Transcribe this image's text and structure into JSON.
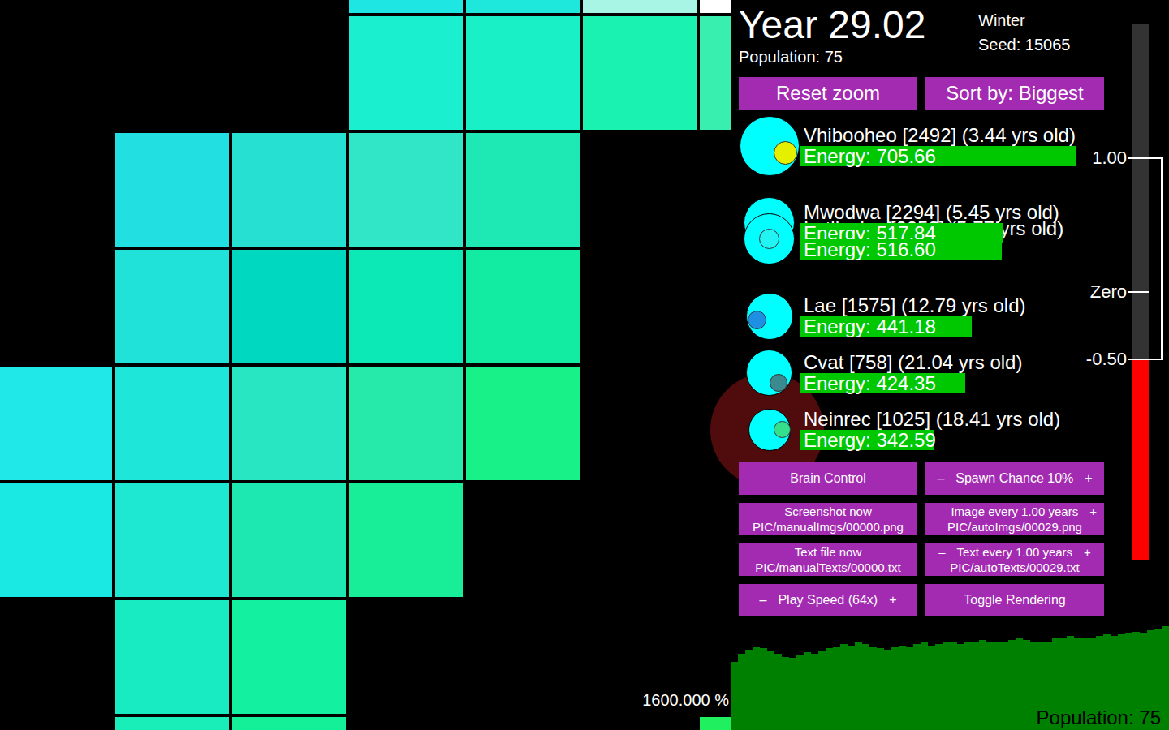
{
  "header": {
    "year": "Year 29.02",
    "season": "Winter",
    "seed": "Seed: 15065",
    "population": "Population: 75"
  },
  "top_buttons": [
    "Reset zoom",
    "Sort by: Biggest"
  ],
  "creatures": [
    {
      "name": "Vhibooheo [2492] (3.44 yrs old)",
      "energy": "Energy: 705.66",
      "level": 0.8,
      "color": "#e4f000"
    },
    {
      "name": "Mwodwa [2294] (5.45 yrs old)",
      "energy": "Energy: 517.84",
      "level": 0.588,
      "color": "#1a8ee0"
    },
    {
      "name": "Latihwius [2259] (5.77 yrs old)",
      "energy": "Energy: 516.60",
      "level": 0.586,
      "color": "#22f4f4"
    },
    {
      "name": "Lae [1575] (12.79 yrs old)",
      "energy": "Energy: 441.18",
      "level": 0.499,
      "color": "#1e90e4"
    },
    {
      "name": "Cvat [758] (21.04 yrs old)",
      "energy": "Energy: 424.35",
      "level": 0.481,
      "color": "#3a8a90"
    },
    {
      "name": "Neinrec [1025] (18.41 yrs old)",
      "energy": "Energy: 342.59",
      "level": 0.388,
      "color": "#34e08c"
    }
  ],
  "controls": [
    {
      "kind": "plain",
      "label": "Brain Control"
    },
    {
      "kind": "stepper",
      "minus": "–",
      "label": "Spawn Chance 10%",
      "plus": "+"
    },
    {
      "kind": "plain",
      "label": "Screenshot now",
      "sub": "PIC/manualImgs/00000.png"
    },
    {
      "kind": "stepper",
      "minus": "–",
      "label": "Image every 1.00 years",
      "plus": "+",
      "sub": "PIC/autoImgs/00029.png"
    },
    {
      "kind": "plain",
      "label": "Text file now",
      "sub": "PIC/manualTexts/00000.txt"
    },
    {
      "kind": "stepper",
      "minus": "–",
      "label": "Text every 1.00 years",
      "plus": "+",
      "sub": "PIC/autoTexts/00029.txt"
    },
    {
      "kind": "stepper",
      "minus": "–",
      "label": "Play Speed (64x)",
      "plus": "+"
    },
    {
      "kind": "plain",
      "label": "Toggle Rendering"
    }
  ],
  "temperature": {
    "level": 0.375,
    "ticks": [
      {
        "label": "1.00",
        "value": 1
      },
      {
        "label": "Zero",
        "value": 0
      },
      {
        "label": "-0.50",
        "value": -0.5
      }
    ]
  },
  "population_chart": {
    "label": "Population: 75",
    "values": [
      49,
      55,
      58,
      60,
      59,
      57,
      55,
      53,
      52,
      54,
      56,
      55,
      57,
      59,
      60,
      62,
      61,
      63,
      62,
      60,
      59,
      58,
      60,
      61,
      60,
      62,
      63,
      61,
      62,
      64,
      63,
      62,
      63,
      64,
      65,
      64,
      63,
      64,
      65,
      66,
      65,
      64,
      63,
      64,
      66,
      67,
      68,
      67,
      66,
      67,
      68,
      69,
      68,
      69,
      70,
      71,
      70,
      72,
      73,
      75
    ]
  },
  "map": {
    "zoom": "1600.000 %",
    "creatures": [
      {
        "color": "#a01818"
      }
    ],
    "tiles": [
      [
        null,
        null,
        null,
        "#1ee6e2",
        "#1ee8dc",
        "#a8f5e6",
        "#ffffff"
      ],
      [
        null,
        null,
        null,
        "#1aefd0",
        "#1af0c6",
        "#1af2b2",
        "#38efb0"
      ],
      [
        null,
        "#22e0e2",
        "#26e0d2",
        "#30e6c6",
        "#1ee8b4",
        null,
        null
      ],
      [
        null,
        "#20e2d8",
        "#00d8c0",
        "#0ce8b6",
        "#12eca2",
        null,
        null
      ],
      [
        "#20e8e8",
        "#1ee6d8",
        "#28e6c2",
        "#26eaaa",
        "#18f088",
        null,
        null
      ],
      [
        "#1ae8e2",
        "#1ee8d2",
        "#1ee8b2",
        "#18ee98",
        null,
        null,
        null
      ],
      [
        null,
        "#18eac2",
        "#12f0a0",
        null,
        null,
        null,
        null
      ],
      [
        null,
        "#1aeeb8",
        "#14f098",
        null,
        null,
        null,
        "#20f060"
      ]
    ]
  }
}
